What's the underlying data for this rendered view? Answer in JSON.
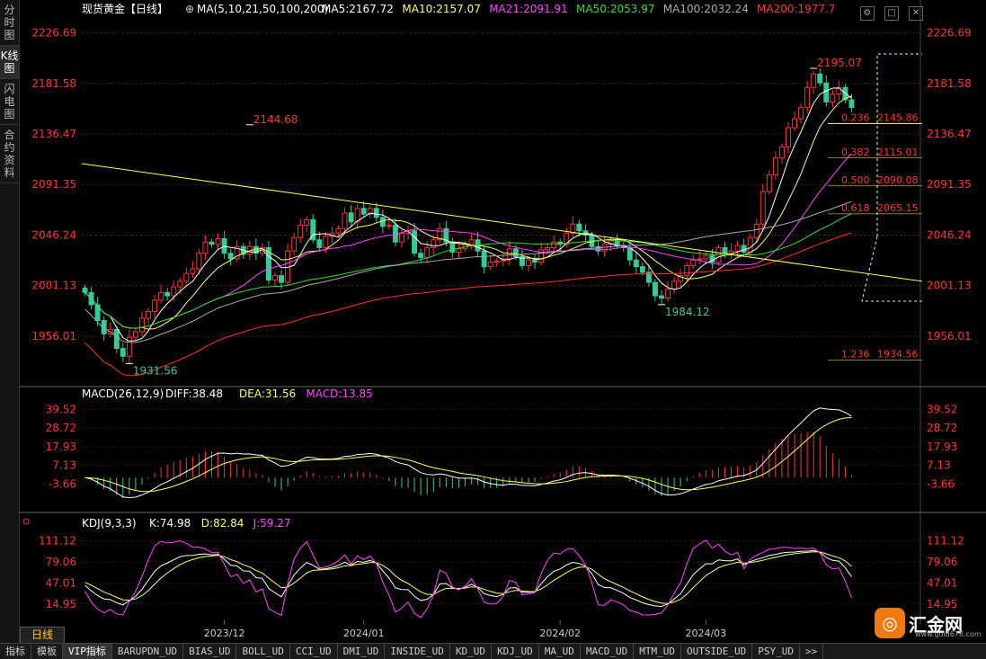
{
  "sidebar": {
    "items": [
      "分时图",
      "K线图",
      "闪电图",
      "合约资料"
    ]
  },
  "period_label": "日线",
  "header": {
    "symbol": "现货黄金【日线】",
    "ma_params": "MA(5,10,21,50,100,200)",
    "ma_values": [
      {
        "text": "MA5:2167.72",
        "color": "#ffffff"
      },
      {
        "text": "MA10:2157.07",
        "color": "#ffff66"
      },
      {
        "text": "MA21:2091.91",
        "color": "#ff44ff"
      },
      {
        "text": "MA50:2053.97",
        "color": "#33dd33"
      },
      {
        "text": "MA100:2032.24",
        "color": "#aaaaaa"
      },
      {
        "text": "MA200:1977.7",
        "color": "#ff3333"
      }
    ]
  },
  "colors": {
    "up": "#ff3333",
    "down": "#33cc99",
    "grid": "#5a1a1a",
    "axis_text": "#ff3333"
  },
  "chart_data": [
    {
      "type": "candlestick",
      "title": "现货黄金【日线】",
      "ylim": [
        1915,
        2240
      ],
      "y_ticks": [
        "2226.69",
        "2181.58",
        "2136.47",
        "2091.35",
        "2046.24",
        "2001.13",
        "1956.01"
      ],
      "x_ticks": [
        "2023/12",
        "2024/01",
        "2024/02",
        "2024/03"
      ],
      "annotations": [
        {
          "text": "2195.07",
          "value": 2195.07,
          "kind": "high"
        },
        {
          "text": "2144.68",
          "value": 2144.68,
          "kind": "high"
        },
        {
          "text": "1984.12",
          "value": 1984.12,
          "kind": "low"
        },
        {
          "text": "1931.56",
          "value": 1931.56,
          "kind": "low"
        }
      ],
      "fibonacci": [
        {
          "ratio": "0.236",
          "price": "2145.86"
        },
        {
          "ratio": "0.382",
          "price": "2115.01"
        },
        {
          "ratio": "0.500",
          "price": "2090.08"
        },
        {
          "ratio": "0.618",
          "price": "2065.15"
        },
        {
          "ratio": "1.236",
          "price": "1934.56"
        }
      ],
      "closes": [
        1995,
        1984,
        1970,
        1958,
        1962,
        1945,
        1938,
        1955,
        1960,
        1972,
        1978,
        1988,
        1995,
        1992,
        2000,
        2005,
        2012,
        2016,
        2030,
        2040,
        2038,
        2043,
        2030,
        2025,
        2036,
        2029,
        2036,
        2030,
        2035,
        2006,
        2010,
        2004,
        2032,
        2044,
        2055,
        2060,
        2042,
        2035,
        2045,
        2048,
        2052,
        2066,
        2058,
        2070,
        2065,
        2070,
        2062,
        2054,
        2055,
        2040,
        2048,
        2050,
        2030,
        2026,
        2035,
        2042,
        2052,
        2040,
        2031,
        2034,
        2038,
        2042,
        2032,
        2018,
        2022,
        2023,
        2025,
        2034,
        2027,
        2019,
        2024,
        2022,
        2033,
        2035,
        2040,
        2038,
        2048,
        2056,
        2050,
        2046,
        2036,
        2032,
        2038,
        2041,
        2037,
        2035,
        2024,
        2018,
        2013,
        2004,
        1992,
        1990,
        1998,
        2005,
        2010,
        2019,
        2024,
        2025,
        2028,
        2022,
        2035,
        2030,
        2032,
        2037,
        2031,
        2044,
        2056,
        2085,
        2100,
        2115,
        2125,
        2142,
        2150,
        2160,
        2178,
        2190,
        2182,
        2165,
        2172,
        2178,
        2167,
        2160
      ],
      "ma_series": [
        {
          "name": "MA5",
          "color": "#ffffff"
        },
        {
          "name": "MA10",
          "color": "#ffff66"
        },
        {
          "name": "MA21",
          "color": "#ff44ff"
        },
        {
          "name": "MA50",
          "color": "#33dd33"
        },
        {
          "name": "MA100",
          "color": "#aaaaaa"
        },
        {
          "name": "MA200",
          "color": "#ff3333"
        }
      ]
    },
    {
      "type": "macd",
      "label": "MACD(26,12,9)",
      "values": [
        {
          "text": "DIFF:38.48",
          "color": "#ffffff"
        },
        {
          "text": "DEA:31.56",
          "color": "#ffff66"
        },
        {
          "text": "MACD:13.85",
          "color": "#ff44ff"
        }
      ],
      "y_ticks": [
        "39.52",
        "28.72",
        "17.93",
        "7.13",
        "-3.66"
      ],
      "ylim": [
        -15,
        45
      ]
    },
    {
      "type": "kdj",
      "label": "KDJ(9,3,3)",
      "values": [
        {
          "text": "K:74.98",
          "color": "#ffffff"
        },
        {
          "text": "D:82.84",
          "color": "#ffff66"
        },
        {
          "text": "J:59.27",
          "color": "#ff44ff"
        }
      ],
      "y_ticks": [
        "111.12",
        "79.06",
        "47.01",
        "14.95"
      ],
      "ylim": [
        -10,
        120
      ]
    }
  ],
  "bottom_tabs": [
    "指标",
    "模板",
    "VIP指标",
    "BARUPDN_UD",
    "BIAS_UD",
    "BOLL_UD",
    "CCI_UD",
    "DMI_UD",
    "INSIDE_UD",
    "KD_UD",
    "KDJ_UD",
    "MA_UD",
    "MACD_UD",
    "MTM_UD",
    "OUTSIDE_UD",
    "PSY_UD",
    ">>"
  ],
  "brand": {
    "logo": "◎",
    "name": "汇金网",
    "url": "www.gold678.com"
  }
}
